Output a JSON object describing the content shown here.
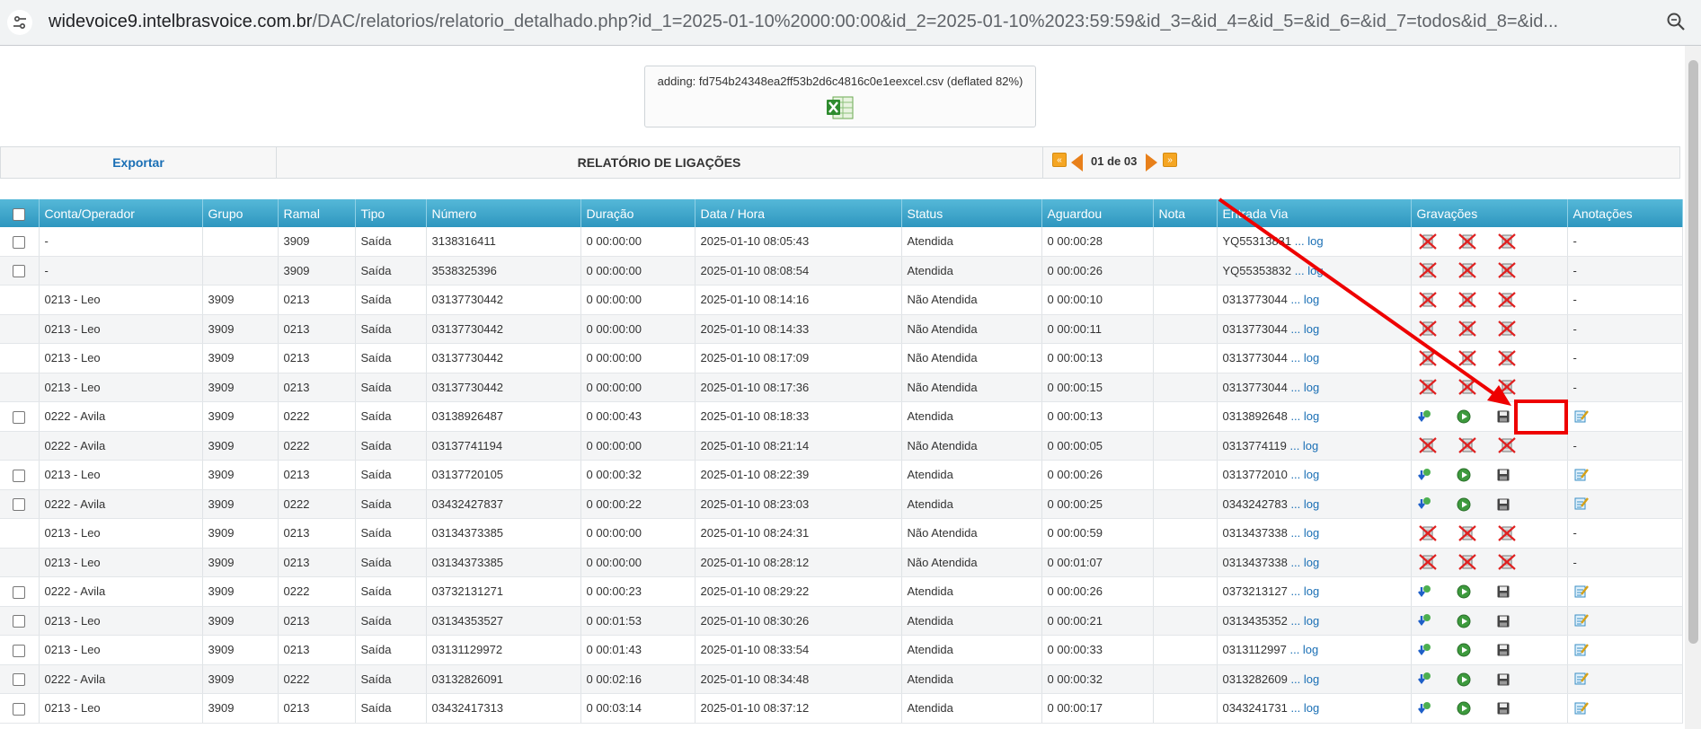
{
  "browser": {
    "url_host": "widevoice9.intelbrasvoice.com.br",
    "url_rest": "/DAC/relatorios/relatorio_detalhado.php?id_1=2025-01-10%2000:00:00&id_2=2025-01-10%2023:59:59&id_3=&id_4=&id_5=&id_6=&id_7=todos&id_8=&id...",
    "site_icon": "tune-icon",
    "zoom_icon": "zoom-icon"
  },
  "notice": {
    "text": "adding: fd754b24348ea2ff53b2d6c4816c0e1eexcel.csv (deflated 82%)",
    "icon": "excel-icon"
  },
  "toolbar": {
    "export_label": "Exportar",
    "report_title": "RELATÓRIO DE LIGAÇÕES",
    "page_indicator": "01 de 03"
  },
  "table": {
    "headers": [
      "Conta/Operador",
      "Grupo",
      "Ramal",
      "Tipo",
      "Número",
      "Duração",
      "Data / Hora",
      "Status",
      "Aguardou",
      "Nota",
      "Entrada Via",
      "Gravações",
      "Anotações"
    ],
    "log_label": "... log",
    "rows": [
      {
        "checkbox": true,
        "conta": "-",
        "grupo": "",
        "ramal": "3909",
        "tipo": "Saída",
        "numero": "3138316411",
        "duracao": "0 00:00:00",
        "datahora": "2025-01-10 08:05:43",
        "status": "Atendida",
        "aguardou": "0 00:00:28",
        "nota": "",
        "entrada": "YQ55313831",
        "recorded": false,
        "anotacao": "-"
      },
      {
        "checkbox": true,
        "conta": "-",
        "grupo": "",
        "ramal": "3909",
        "tipo": "Saída",
        "numero": "3538325396",
        "duracao": "0 00:00:00",
        "datahora": "2025-01-10 08:08:54",
        "status": "Atendida",
        "aguardou": "0 00:00:26",
        "nota": "",
        "entrada": "YQ55353832",
        "recorded": false,
        "anotacao": "-"
      },
      {
        "checkbox": false,
        "conta": "0213 - Leo",
        "grupo": "3909",
        "ramal": "0213",
        "tipo": "Saída",
        "numero": "03137730442",
        "duracao": "0 00:00:00",
        "datahora": "2025-01-10 08:14:16",
        "status": "Não Atendida",
        "aguardou": "0 00:00:10",
        "nota": "",
        "entrada": "0313773044",
        "recorded": false,
        "anotacao": "-"
      },
      {
        "checkbox": false,
        "conta": "0213 - Leo",
        "grupo": "3909",
        "ramal": "0213",
        "tipo": "Saída",
        "numero": "03137730442",
        "duracao": "0 00:00:00",
        "datahora": "2025-01-10 08:14:33",
        "status": "Não Atendida",
        "aguardou": "0 00:00:11",
        "nota": "",
        "entrada": "0313773044",
        "recorded": false,
        "anotacao": "-"
      },
      {
        "checkbox": false,
        "conta": "0213 - Leo",
        "grupo": "3909",
        "ramal": "0213",
        "tipo": "Saída",
        "numero": "03137730442",
        "duracao": "0 00:00:00",
        "datahora": "2025-01-10 08:17:09",
        "status": "Não Atendida",
        "aguardou": "0 00:00:13",
        "nota": "",
        "entrada": "0313773044",
        "recorded": false,
        "anotacao": "-"
      },
      {
        "checkbox": false,
        "conta": "0213 - Leo",
        "grupo": "3909",
        "ramal": "0213",
        "tipo": "Saída",
        "numero": "03137730442",
        "duracao": "0 00:00:00",
        "datahora": "2025-01-10 08:17:36",
        "status": "Não Atendida",
        "aguardou": "0 00:00:15",
        "nota": "",
        "entrada": "0313773044",
        "recorded": false,
        "anotacao": "-"
      },
      {
        "checkbox": true,
        "conta": "0222 - Avila",
        "grupo": "3909",
        "ramal": "0222",
        "tipo": "Saída",
        "numero": "03138926487",
        "duracao": "0 00:00:43",
        "datahora": "2025-01-10 08:18:33",
        "status": "Atendida",
        "aguardou": "0 00:00:13",
        "nota": "",
        "entrada": "0313892648",
        "recorded": true,
        "anotacao": "note"
      },
      {
        "checkbox": false,
        "conta": "0222 - Avila",
        "grupo": "3909",
        "ramal": "0222",
        "tipo": "Saída",
        "numero": "03137741194",
        "duracao": "0 00:00:00",
        "datahora": "2025-01-10 08:21:14",
        "status": "Não Atendida",
        "aguardou": "0 00:00:05",
        "nota": "",
        "entrada": "0313774119",
        "recorded": false,
        "anotacao": "-"
      },
      {
        "checkbox": true,
        "conta": "0213 - Leo",
        "grupo": "3909",
        "ramal": "0213",
        "tipo": "Saída",
        "numero": "03137720105",
        "duracao": "0 00:00:32",
        "datahora": "2025-01-10 08:22:39",
        "status": "Atendida",
        "aguardou": "0 00:00:26",
        "nota": "",
        "entrada": "0313772010",
        "recorded": true,
        "anotacao": "note"
      },
      {
        "checkbox": true,
        "conta": "0222 - Avila",
        "grupo": "3909",
        "ramal": "0222",
        "tipo": "Saída",
        "numero": "03432427837",
        "duracao": "0 00:00:22",
        "datahora": "2025-01-10 08:23:03",
        "status": "Atendida",
        "aguardou": "0 00:00:25",
        "nota": "",
        "entrada": "0343242783",
        "recorded": true,
        "anotacao": "note"
      },
      {
        "checkbox": false,
        "conta": "0213 - Leo",
        "grupo": "3909",
        "ramal": "0213",
        "tipo": "Saída",
        "numero": "03134373385",
        "duracao": "0 00:00:00",
        "datahora": "2025-01-10 08:24:31",
        "status": "Não Atendida",
        "aguardou": "0 00:00:59",
        "nota": "",
        "entrada": "0313437338",
        "recorded": false,
        "anotacao": "-"
      },
      {
        "checkbox": false,
        "conta": "0213 - Leo",
        "grupo": "3909",
        "ramal": "0213",
        "tipo": "Saída",
        "numero": "03134373385",
        "duracao": "0 00:00:00",
        "datahora": "2025-01-10 08:28:12",
        "status": "Não Atendida",
        "aguardou": "0 00:01:07",
        "nota": "",
        "entrada": "0313437338",
        "recorded": false,
        "anotacao": "-"
      },
      {
        "checkbox": true,
        "conta": "0222 - Avila",
        "grupo": "3909",
        "ramal": "0222",
        "tipo": "Saída",
        "numero": "03732131271",
        "duracao": "0 00:00:23",
        "datahora": "2025-01-10 08:29:22",
        "status": "Atendida",
        "aguardou": "0 00:00:26",
        "nota": "",
        "entrada": "0373213127",
        "recorded": true,
        "anotacao": "note"
      },
      {
        "checkbox": true,
        "conta": "0213 - Leo",
        "grupo": "3909",
        "ramal": "0213",
        "tipo": "Saída",
        "numero": "03134353527",
        "duracao": "0 00:01:53",
        "datahora": "2025-01-10 08:30:26",
        "status": "Atendida",
        "aguardou": "0 00:00:21",
        "nota": "",
        "entrada": "0313435352",
        "recorded": true,
        "anotacao": "note"
      },
      {
        "checkbox": true,
        "conta": "0213 - Leo",
        "grupo": "3909",
        "ramal": "0213",
        "tipo": "Saída",
        "numero": "03131129972",
        "duracao": "0 00:01:43",
        "datahora": "2025-01-10 08:33:54",
        "status": "Atendida",
        "aguardou": "0 00:00:33",
        "nota": "",
        "entrada": "0313112997",
        "recorded": true,
        "anotacao": "note"
      },
      {
        "checkbox": true,
        "conta": "0222 - Avila",
        "grupo": "3909",
        "ramal": "0222",
        "tipo": "Saída",
        "numero": "03132826091",
        "duracao": "0 00:02:16",
        "datahora": "2025-01-10 08:34:48",
        "status": "Atendida",
        "aguardou": "0 00:00:32",
        "nota": "",
        "entrada": "0313282609",
        "recorded": true,
        "anotacao": "note"
      },
      {
        "checkbox": true,
        "conta": "0213 - Leo",
        "grupo": "3909",
        "ramal": "0213",
        "tipo": "Saída",
        "numero": "03432417313",
        "duracao": "0 00:03:14",
        "datahora": "2025-01-10 08:37:12",
        "status": "Atendida",
        "aguardou": "0 00:00:17",
        "nota": "",
        "entrada": "0343241731",
        "recorded": true,
        "anotacao": "note"
      }
    ]
  },
  "colors": {
    "header_bg": "#3aa6cc",
    "link": "#1a6fb5",
    "pager_orange": "#f5a623",
    "annotation_red": "#ee0000"
  }
}
